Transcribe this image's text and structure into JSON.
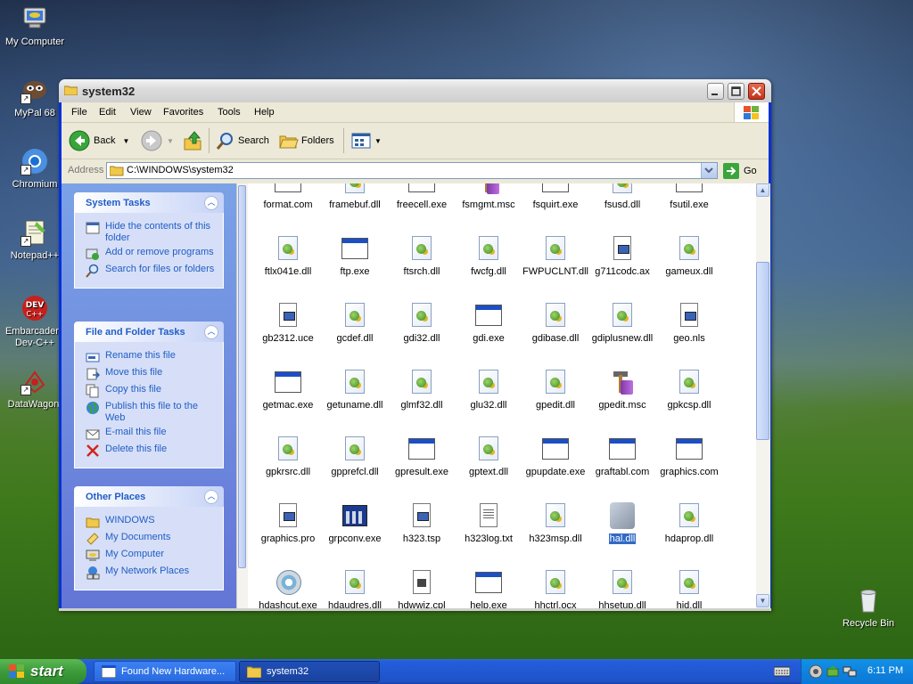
{
  "desktop": {
    "icons": [
      {
        "label": "My Computer"
      },
      {
        "label": "MyPal 68"
      },
      {
        "label": "Chromium"
      },
      {
        "label": "Notepad++"
      },
      {
        "label": "Embarcadero Dev-C++"
      },
      {
        "label": "DataWagon."
      },
      {
        "label": "Recycle Bin"
      }
    ]
  },
  "window": {
    "title": "system32",
    "menus": [
      "File",
      "Edit",
      "View",
      "Favorites",
      "Tools",
      "Help"
    ],
    "toolbar": {
      "back": "Back",
      "search": "Search",
      "folders": "Folders"
    },
    "address": {
      "label": "Address",
      "value": "C:\\WINDOWS\\system32",
      "go": "Go"
    }
  },
  "leftpane": {
    "system_tasks": {
      "title": "System Tasks",
      "items": [
        "Hide the contents of this folder",
        "Add or remove programs",
        "Search for files or folders"
      ]
    },
    "file_tasks": {
      "title": "File and Folder Tasks",
      "items": [
        "Rename this file",
        "Move this file",
        "Copy this file",
        "Publish this file to the Web",
        "E-mail this file",
        "Delete this file"
      ]
    },
    "other_places": {
      "title": "Other Places",
      "items": [
        "WINDOWS",
        "My Documents",
        "My Computer",
        "My Network Places"
      ]
    }
  },
  "files": {
    "rows": [
      [
        "format.com",
        "framebuf.dll",
        "freecell.exe",
        "fsmgmt.msc",
        "fsquirt.exe",
        "fsusd.dll",
        "fsutil.exe"
      ],
      [
        "ftlx041e.dll",
        "ftp.exe",
        "ftsrch.dll",
        "fwcfg.dll",
        "FWPUCLNT.dll",
        "g711codc.ax",
        "gameux.dll"
      ],
      [
        "gb2312.uce",
        "gcdef.dll",
        "gdi32.dll",
        "gdi.exe",
        "gdibase.dll",
        "gdiplusnew.dll",
        "geo.nls"
      ],
      [
        "getmac.exe",
        "getuname.dll",
        "glmf32.dll",
        "glu32.dll",
        "gpedit.dll",
        "gpedit.msc",
        "gpkcsp.dll"
      ],
      [
        "gpkrsrc.dll",
        "gpprefcl.dll",
        "gpresult.exe",
        "gptext.dll",
        "gpupdate.exe",
        "graftabl.com",
        "graphics.com"
      ],
      [
        "graphics.pro",
        "grpconv.exe",
        "h323.tsp",
        "h323log.txt",
        "h323msp.dll",
        "hal.dll",
        "hdaprop.dll"
      ],
      [
        "hdashcut.exe",
        "hdaudres.dll",
        "hdwwiz.cpl",
        "help.exe",
        "hhctrl.ocx",
        "hhsetup.dll",
        "hid.dll"
      ]
    ],
    "selected": "hal.dll"
  },
  "taskbar": {
    "start": "start",
    "buttons": [
      "Found New Hardware...",
      "system32"
    ],
    "clock": "6:11 PM"
  }
}
